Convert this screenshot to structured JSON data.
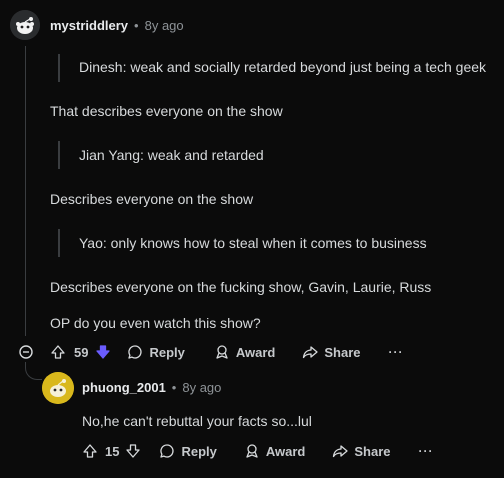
{
  "comment": {
    "author": "mystriddlery",
    "sep": "•",
    "age": "8y ago",
    "quotes": [
      "Dinesh: weak and socially retarded beyond just being a tech geek",
      "Jian Yang: weak and retarded",
      "Yao: only knows how to steal when it comes to business"
    ],
    "paragraphs": [
      "That describes everyone on the show",
      "Describes everyone on the show",
      "Describes everyone on the fucking show, Gavin, Laurie, Russ",
      "OP do you even watch this show?"
    ],
    "votes": "59",
    "actions": {
      "reply": "Reply",
      "award": "Award",
      "share": "Share",
      "more": "···"
    }
  },
  "reply": {
    "author": "phuong_2001",
    "sep": "•",
    "age": "8y ago",
    "text": "No,he can't rebuttal your facts so...lul",
    "votes": "15",
    "actions": {
      "reply": "Reply",
      "award": "Award",
      "share": "Share",
      "more": "···"
    }
  },
  "colors": {
    "background": "#0b0b0b",
    "downvote_active": "#6a5cff",
    "reply_avatar": "#d9b81c"
  }
}
